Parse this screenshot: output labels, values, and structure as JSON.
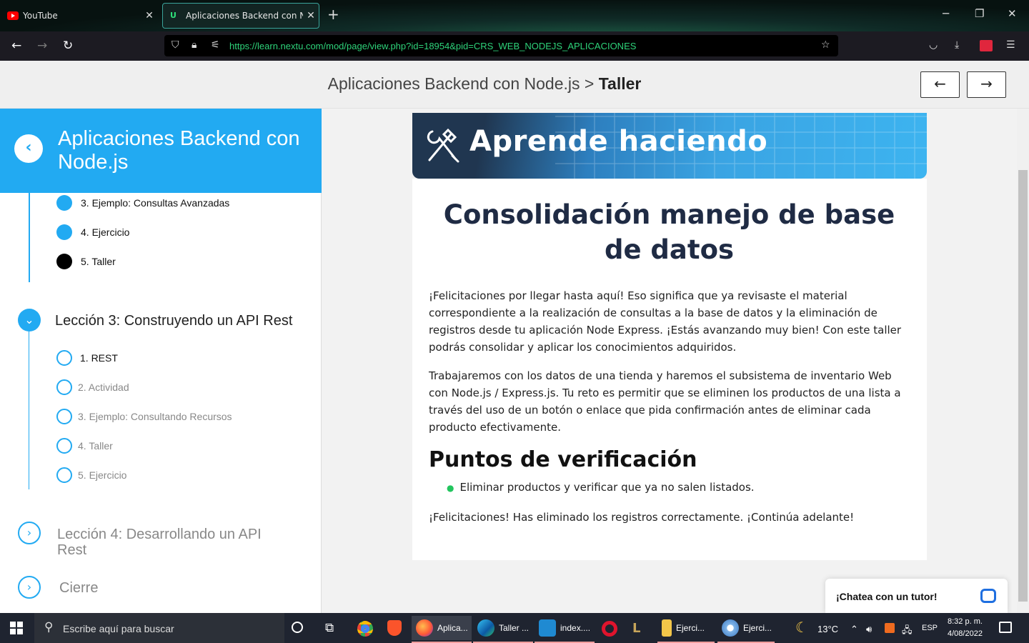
{
  "browser": {
    "tabs": [
      {
        "title": "YouTube",
        "active": false
      },
      {
        "title": "Aplicaciones Backend con Node.js",
        "active": true
      }
    ],
    "url": "https://learn.nextu.com/mod/page/view.php?id=18954&pid=CRS_WEB_NODEJS_APLICACIONES",
    "url_host": "nextu.com"
  },
  "header": {
    "course": "Aplicaciones Backend con Node.js",
    "separator": ">",
    "page": "Taller",
    "prev_label": "←",
    "next_label": "→"
  },
  "sidebar": {
    "title": "Aplicaciones Backend con Node.js",
    "lesson2_items": [
      {
        "label": "3. Ejemplo: Consultas Avanzadas",
        "state": "done"
      },
      {
        "label": "4. Ejercicio",
        "state": "done"
      },
      {
        "label": "5. Taller",
        "state": "current"
      }
    ],
    "lesson3": {
      "title": "Lección 3: Construyendo un API Rest",
      "items": [
        {
          "label": "1. REST",
          "state": "todo"
        },
        {
          "label": "2. Actividad",
          "state": "locked"
        },
        {
          "label": "3. Ejemplo: Consultando Recursos",
          "state": "locked"
        },
        {
          "label": "4. Taller",
          "state": "locked"
        },
        {
          "label": "5. Ejercicio",
          "state": "locked"
        }
      ]
    },
    "lesson4": {
      "title": "Lección 4: Desarrollando un API Rest"
    },
    "closing": {
      "title": "Cierre"
    }
  },
  "content": {
    "banner": "Aprende haciendo",
    "title": "Consolidación manejo de base de datos",
    "paragraph1": "¡Felicitaciones por llegar hasta aquí! Eso significa que ya revisaste el material correspondiente a la realización de consultas a la base de datos y la eliminación de registros desde tu aplicación Node Express. ¡Estás avanzando muy bien! Con este taller podrás consolidar y aplicar los conocimientos adquiridos.",
    "paragraph2": "Trabajaremos con los datos de una tienda y haremos el subsistema de inventario Web con Node.js / Express.js. Tu reto es  permitir que se eliminen los productos de una lista a través del uso de un botón o enlace que pida confirmación antes de eliminar cada producto efectivamente.",
    "checkpoints_heading": "Puntos de verificación",
    "checkpoints": [
      "Eliminar productos y verificar que ya no salen listados."
    ],
    "closing": "¡Felicitaciones! Has eliminado los registros correctamente. ¡Continúa adelante!"
  },
  "chat": {
    "label": "¡Chatea con un tutor!"
  },
  "taskbar": {
    "search_placeholder": "Escribe aquí para buscar",
    "apps": [
      {
        "label": "Aplica...",
        "icon": "firefox-icon"
      },
      {
        "label": "Taller ...",
        "icon": "edge-icon"
      },
      {
        "label": "index....",
        "icon": "vscode-icon"
      },
      {
        "label": "Ejerci...",
        "icon": "folder-icon"
      },
      {
        "label": "Ejerci...",
        "icon": "paint-icon"
      }
    ],
    "weather": "13°C",
    "language": "ESP",
    "time": "8:32 p. m.",
    "date": "4/08/2022"
  },
  "colors": {
    "accent": "#22aaf2",
    "heading": "#1f2b44",
    "url": "#2ed37a",
    "taskbar": "#1f2430"
  }
}
